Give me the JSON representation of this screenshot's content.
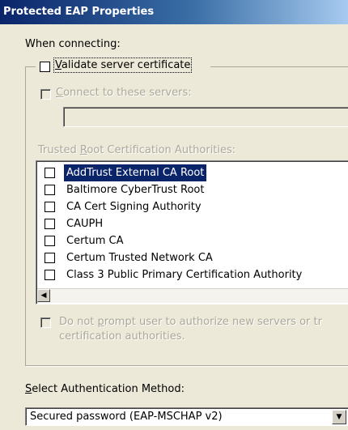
{
  "window": {
    "title": "Protected EAP Properties"
  },
  "connecting": {
    "label": "When connecting:",
    "validate": {
      "label_first": "V",
      "label_rest": "alidate server certificate",
      "checked": false
    },
    "connect_servers": {
      "label_first": "C",
      "label_rest": "onnect to these servers:",
      "checked": false,
      "enabled": false,
      "value": ""
    }
  },
  "trusted_roots": {
    "label_a": "Trusted ",
    "label_b": "R",
    "label_c": "oot Certification Authorities:",
    "items": [
      {
        "label": "AddTrust External CA Root",
        "checked": false,
        "selected": true
      },
      {
        "label": "Baltimore CyberTrust Root",
        "checked": false,
        "selected": false
      },
      {
        "label": "CA Cert Signing Authority",
        "checked": false,
        "selected": false
      },
      {
        "label": "CAUPH",
        "checked": false,
        "selected": false
      },
      {
        "label": "Certum CA",
        "checked": false,
        "selected": false
      },
      {
        "label": "Certum Trusted Network CA",
        "checked": false,
        "selected": false
      },
      {
        "label": "Class 3 Public Primary Certification Authority",
        "checked": false,
        "selected": false
      }
    ]
  },
  "no_prompt": {
    "line1_a": "Do not ",
    "line1_b": "p",
    "line1_c": "rompt user to authorize new servers or tr",
    "line2": "certification authorities.",
    "checked": false,
    "enabled": false
  },
  "auth_method": {
    "label_first": "S",
    "label_rest": "elect Authentication Method:",
    "selected": "Secured password (EAP-MSCHAP v2)"
  },
  "icons": {
    "dropdown": "triangle-down",
    "scroll_left": "triangle-left"
  },
  "colors": {
    "title_bar": "#0a246a",
    "selection": "#0a246a",
    "dialog_bg": "#ece9d8"
  }
}
